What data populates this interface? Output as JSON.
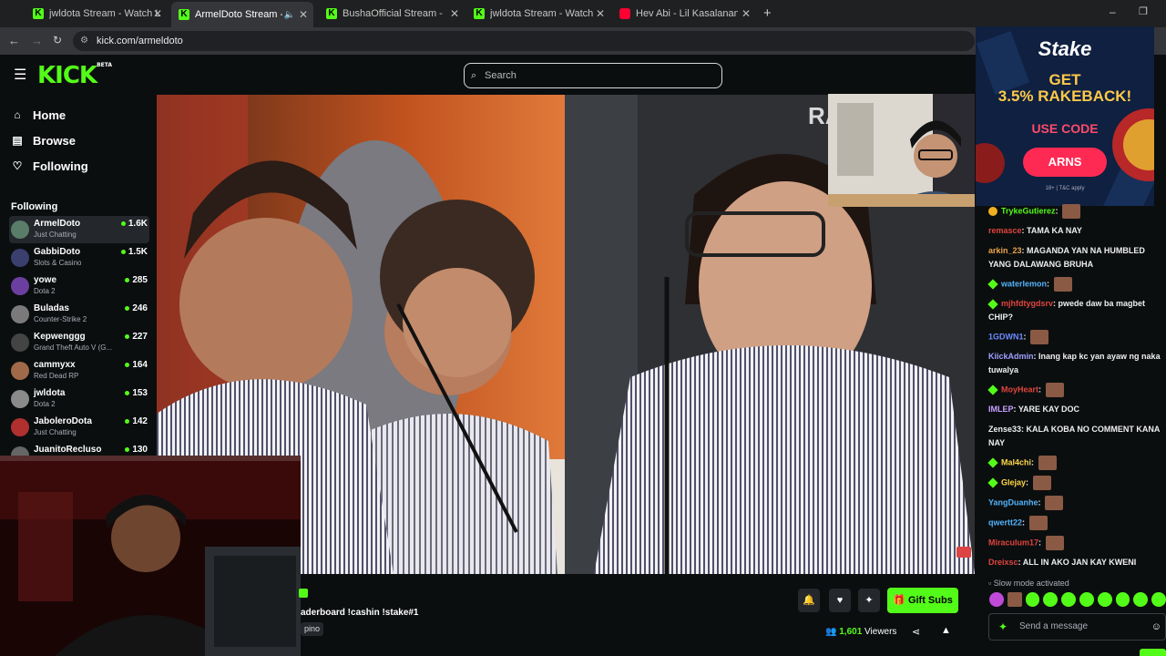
{
  "browser": {
    "tabs": [
      {
        "title": "jwldota Stream - Watch Live on",
        "icon": "kick-favicon",
        "active": false
      },
      {
        "title": "ArmelDoto Stream - Watch",
        "icon": "kick-favicon",
        "active": true
      },
      {
        "title": "BushaOfficial Stream - Watch Li",
        "icon": "kick-favicon",
        "active": false
      },
      {
        "title": "jwldota Stream - Watch Live on",
        "icon": "kick-favicon",
        "active": false
      },
      {
        "title": "Hev Abi - Lil Kasalanan Shortie",
        "icon": "youtube-favicon",
        "active": false
      }
    ],
    "url": "kick.com/armeldoto"
  },
  "header": {
    "logo": "KICK",
    "logo_badge": "BETA",
    "search_placeholder": "Search"
  },
  "sidebar": {
    "nav": [
      {
        "label": "Home",
        "icon": "home-icon"
      },
      {
        "label": "Browse",
        "icon": "browse-icon"
      },
      {
        "label": "Following",
        "icon": "heart-icon"
      }
    ],
    "following_title": "Following",
    "channels": [
      {
        "name": "ArmelDoto",
        "category": "Just Chatting",
        "viewers": "1.6K",
        "active": true,
        "avatar": "#5a7d6a"
      },
      {
        "name": "GabbiDoto",
        "category": "Slots & Casino",
        "viewers": "1.5K",
        "active": false,
        "avatar": "#3a3f6e"
      },
      {
        "name": "yowe",
        "category": "Dota 2",
        "viewers": "285",
        "active": false,
        "avatar": "#6b3fa0"
      },
      {
        "name": "Buladas",
        "category": "Counter-Strike 2",
        "viewers": "246",
        "active": false,
        "avatar": "#7a7a7a"
      },
      {
        "name": "Kepwenggg",
        "category": "Grand Theft Auto V (G...",
        "viewers": "227",
        "active": false,
        "avatar": "#444444"
      },
      {
        "name": "cammyxx",
        "category": "Red Dead RP",
        "viewers": "164",
        "active": false,
        "avatar": "#a06a4a"
      },
      {
        "name": "jwldota",
        "category": "Dota 2",
        "viewers": "153",
        "active": false,
        "avatar": "#8a8a8a"
      },
      {
        "name": "JaboleroDota",
        "category": "Just Chatting",
        "viewers": "142",
        "active": false,
        "avatar": "#b03030"
      },
      {
        "name": "JuanitoReclusо",
        "category": "",
        "viewers": "130",
        "active": false,
        "avatar": "#666666"
      }
    ]
  },
  "video": {
    "overlay_text": "RA"
  },
  "stream": {
    "title": "aderboard !cashin !stake#1",
    "tag": "pino",
    "gift_label": "Gift Subs",
    "viewer_count": "1,601",
    "viewers_label": "Viewers"
  },
  "ad": {
    "brand": "Stake",
    "headline_1": "GET",
    "headline_2": "3.5% RAKEBACK!",
    "use_code": "USE CODE",
    "code": "ARNS",
    "fineprint": "18+ | T&C apply"
  },
  "chat": {
    "messages": [
      {
        "user": "TrykeGutierez",
        "color": "#53fc18",
        "text": "",
        "emote": true,
        "badge": "gold"
      },
      {
        "user": "remasce",
        "color": "#e0443e",
        "text": "TAMA KA NAY",
        "emote": false,
        "badge": ""
      },
      {
        "user": "arkin_23",
        "color": "#e8a44a",
        "text": "MAGANDA YAN NA HUMBLED YANG DALAWANG BRUHA",
        "emote": false,
        "badge": ""
      },
      {
        "user": "waterlemon",
        "color": "#53b3fc",
        "text": "",
        "emote": true,
        "badge": "green"
      },
      {
        "user": "mjhfdtygdsrv",
        "color": "#e0443e",
        "text": "pwede daw ba magbet CHIP?",
        "emote": false,
        "badge": "green"
      },
      {
        "user": "1GDWN1",
        "color": "#6a8cff",
        "text": "",
        "emote": true,
        "badge": ""
      },
      {
        "user": "KiickAdmin",
        "color": "#a0a0ff",
        "text": "Inang kap kc yan ayaw ng naka tuwalya",
        "emote": false,
        "badge": ""
      },
      {
        "user": "MoyHeart",
        "color": "#e0443e",
        "text": "",
        "emote": true,
        "badge": "green"
      },
      {
        "user": "IMLEP",
        "color": "#c8a0ff",
        "text": "YARE KAY DOC",
        "emote": false,
        "badge": ""
      },
      {
        "user": "Zense33",
        "color": "#efeff1",
        "text": "KALA KOBA NO COMMENT KANA NAY",
        "emote": false,
        "badge": ""
      },
      {
        "user": "Mal4chi",
        "color": "#ffd84a",
        "text": "",
        "emote": true,
        "badge": "green"
      },
      {
        "user": "Glejay",
        "color": "#ffd84a",
        "text": "",
        "emote": true,
        "badge": "green"
      },
      {
        "user": "YangDuanhe",
        "color": "#53b3fc",
        "text": "",
        "emote": true,
        "badge": ""
      },
      {
        "user": "qwertt22",
        "color": "#53b3fc",
        "text": "",
        "emote": true,
        "badge": ""
      },
      {
        "user": "Miraculum17",
        "color": "#e0443e",
        "text": "",
        "emote": true,
        "badge": ""
      },
      {
        "user": "Dreixsc",
        "color": "#e0443e",
        "text": "ALL IN AKO JAN KAY KWENI",
        "emote": false,
        "badge": ""
      }
    ],
    "slow_mode": "Slow mode activated",
    "input_placeholder": "Send a message"
  },
  "colors": {
    "accent": "#53fc18",
    "background": "#0b0e0f"
  }
}
